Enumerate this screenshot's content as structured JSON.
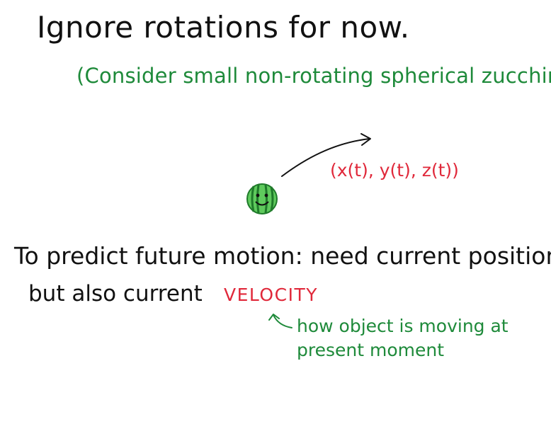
{
  "title": "Ignore rotations for now.",
  "subtitle": "(Consider small non-rotating spherical zucchini)",
  "coords_label": "(x(t), y(t), z(t))",
  "predict_line": "To predict future motion: need current position",
  "but_also_line": "but also current",
  "velocity_label": "VELOCITY",
  "explanation": {
    "line1": "how object is moving at",
    "line2": "present moment"
  },
  "icons": {
    "zucchini": "smiling-zucchini-icon",
    "trajectory": "curved-arrow-icon",
    "pointer": "hook-arrow-icon"
  },
  "colors": {
    "ink": "#111111",
    "green": "#1e8a3a",
    "red": "#e0283a",
    "zucchini_light": "#6fd16b",
    "zucchini_dark": "#1f7a2a"
  }
}
